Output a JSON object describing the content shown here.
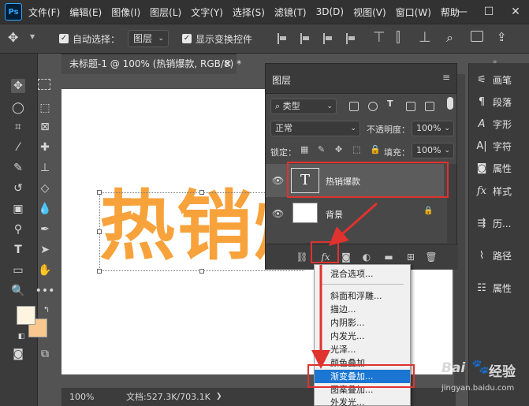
{
  "app": {
    "logo": "Ps"
  },
  "menubar": {
    "items": [
      "文件(F)",
      "编辑(E)",
      "图像(I)",
      "图层(L)",
      "文字(Y)",
      "选择(S)",
      "滤镜(T)",
      "3D(D)",
      "视图(V)",
      "窗口(W)",
      "帮助"
    ]
  },
  "options": {
    "auto_select_label": "自动选择：",
    "auto_select_target": "图层",
    "show_transform_label": "显示变换控件"
  },
  "document": {
    "tab_title": "未标题-1 @ 100% (热销爆款, RGB/8) *",
    "canvas_text": "热销爆",
    "zoom": "100%",
    "doc_size": "文档:527.3K/703.1K"
  },
  "layers_panel": {
    "title": "图层",
    "filter_kind": "类型",
    "blend_mode": "正常",
    "opacity_label": "不透明度：",
    "opacity_value": "100%",
    "lock_label": "锁定：",
    "fill_label": "填充：",
    "fill_value": "100%",
    "layers": [
      {
        "name": "热销爆款",
        "type": "text",
        "thumb_glyph": "T",
        "selected": true
      },
      {
        "name": "背景",
        "type": "background",
        "locked": true,
        "selected": false
      }
    ],
    "fx_label": "fx"
  },
  "fx_menu": {
    "items": [
      "混合选项...",
      "斜面和浮雕...",
      "描边...",
      "内阴影...",
      "内发光...",
      "光泽...",
      "颜色叠加...",
      "渐变叠加...",
      "图案叠加...",
      "外发光..."
    ],
    "highlighted": "渐变叠加..."
  },
  "dock": {
    "items": [
      "画笔",
      "段落",
      "字形",
      "字符",
      "属性",
      "样式",
      "历...",
      "路径",
      "属性"
    ]
  },
  "colors": {
    "canvas_text": "#f7a23b",
    "foreground": "#fff4e0",
    "background": "#f8c88f",
    "annotation_red": "#e0322f",
    "menu_highlight": "#1a76d2"
  },
  "watermark": {
    "brand": "Bai",
    "name": "经验",
    "url": "jingyan.baidu.com"
  }
}
